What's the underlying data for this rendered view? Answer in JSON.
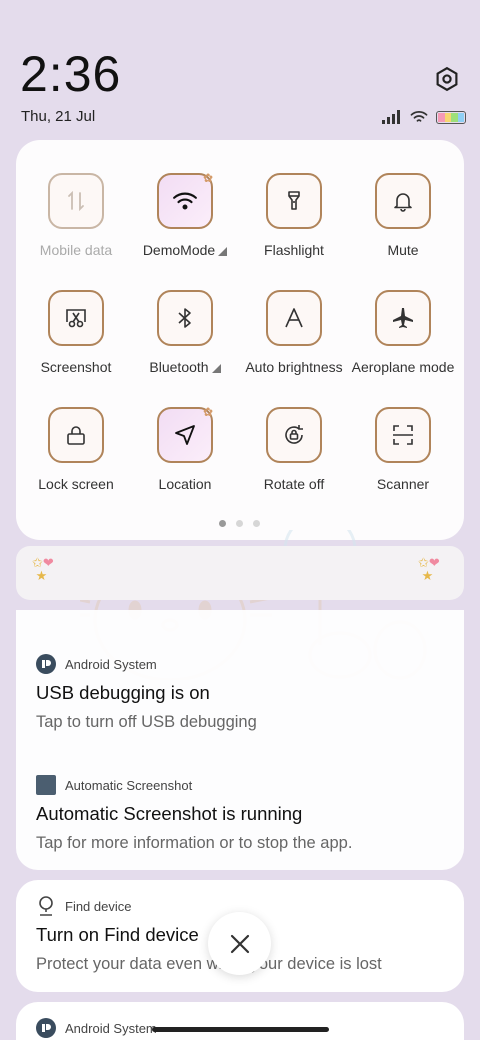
{
  "status": {
    "time": "2:36",
    "date": "Thu, 21 Jul"
  },
  "quick_settings": {
    "tiles": [
      {
        "label": "Mobile data",
        "icon": "mobile-data-icon",
        "state": "disabled"
      },
      {
        "label": "DemoMode",
        "icon": "wifi-icon",
        "state": "active",
        "expandable": true
      },
      {
        "label": "Flashlight",
        "icon": "flashlight-icon",
        "state": "off"
      },
      {
        "label": "Mute",
        "icon": "bell-icon",
        "state": "off"
      },
      {
        "label": "Screenshot",
        "icon": "screenshot-icon",
        "state": "off"
      },
      {
        "label": "Bluetooth",
        "icon": "bluetooth-icon",
        "state": "off",
        "expandable": true
      },
      {
        "label": "Auto brightness",
        "icon": "auto-brightness-icon",
        "state": "off"
      },
      {
        "label": "Aeroplane mode",
        "icon": "airplane-icon",
        "state": "off"
      },
      {
        "label": "Lock screen",
        "icon": "lock-icon",
        "state": "off"
      },
      {
        "label": "Location",
        "icon": "location-icon",
        "state": "active"
      },
      {
        "label": "Rotate off",
        "icon": "rotate-lock-icon",
        "state": "off"
      },
      {
        "label": "Scanner",
        "icon": "scanner-icon",
        "state": "off"
      }
    ],
    "page_indicator": {
      "pages": 3,
      "current": 1
    }
  },
  "notifications": [
    {
      "app": "Android System",
      "title": "USB debugging is on",
      "body": "Tap to turn off USB debugging"
    },
    {
      "app": "Automatic Screenshot",
      "title": "Automatic Screenshot is running",
      "body": "Tap for more information or to stop the app."
    },
    {
      "app": "Find device",
      "title": "Turn on Find device",
      "body": "Protect your data even when your device is lost"
    },
    {
      "app": "Android System"
    }
  ],
  "colors": {
    "tile_border": "#b0845a",
    "background": "#e4dcec",
    "active_tile": "#f2ddf4"
  }
}
